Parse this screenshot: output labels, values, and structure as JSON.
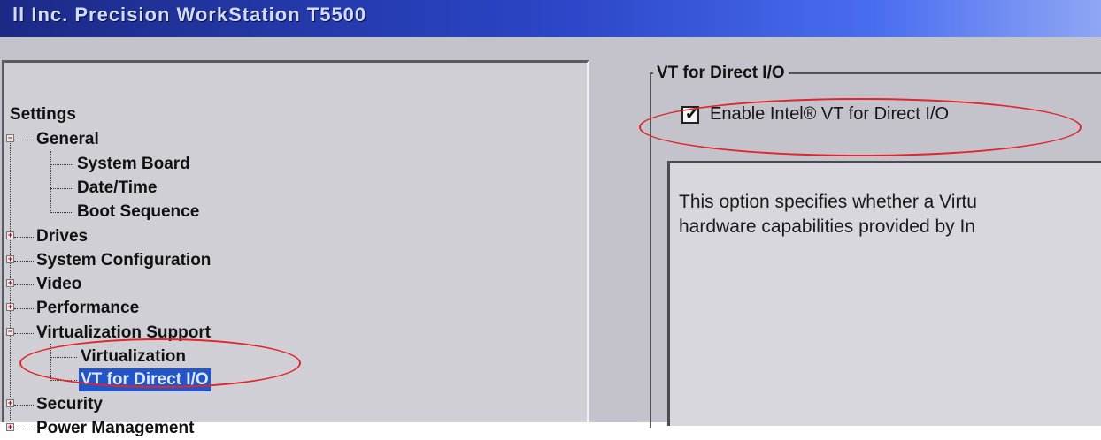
{
  "window": {
    "title": "ll Inc. Precision WorkStation T5500"
  },
  "tree": {
    "root": "Settings",
    "items": [
      {
        "label": "General",
        "level": 0,
        "expander": "minus"
      },
      {
        "label": "System Board",
        "level": 1
      },
      {
        "label": "Date/Time",
        "level": 1
      },
      {
        "label": "Boot Sequence",
        "level": 1
      },
      {
        "label": "Drives",
        "level": 0,
        "expander": "plus"
      },
      {
        "label": "System Configuration",
        "level": 0,
        "expander": "plus"
      },
      {
        "label": "Video",
        "level": 0,
        "expander": "plus"
      },
      {
        "label": "Performance",
        "level": 0,
        "expander": "plus"
      },
      {
        "label": "Virtualization Support",
        "level": 0,
        "expander": "minus"
      },
      {
        "label": "Virtualization",
        "level": 1
      },
      {
        "label": "VT for Direct I/O",
        "level": 1,
        "selected": true
      },
      {
        "label": "Security",
        "level": 0,
        "expander": "plus"
      },
      {
        "label": "Power Management",
        "level": 0,
        "expander": "plus"
      }
    ]
  },
  "detail": {
    "group_title": "VT for Direct I/O",
    "checkbox": {
      "label": "Enable Intel® VT for Direct I/O",
      "checked": true
    },
    "description_line1": "This option specifies whether a Virtu",
    "description_line2": "hardware capabilities provided by In"
  },
  "colors": {
    "title_bar": "#2a45c6",
    "selection": "#2256c8",
    "annotation": "#e0262b",
    "panel_background": "#c4c3cb"
  }
}
